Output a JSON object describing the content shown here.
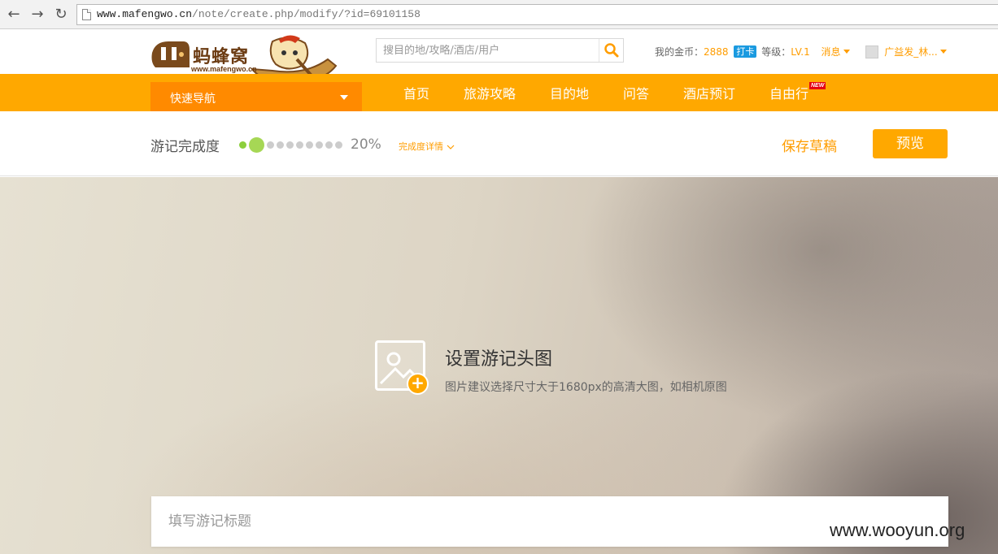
{
  "browser": {
    "back_glyph": "←",
    "forward_glyph": "→",
    "reload_glyph": "↻",
    "url_host": "www.mafengwo.cn",
    "url_path": "/note/create.php/modify/?id=69101158"
  },
  "header": {
    "logo_text": "蚂蜂窝",
    "logo_url": "www.mafengwo.cn",
    "search_placeholder": "搜目的地/攻略/酒店/用户",
    "coins_label": "我的金币：",
    "coins_value": "2888",
    "checkin_label": "打卡",
    "level_label": "等级：",
    "level_value": "LV.1",
    "messages_label": "消息",
    "username": "广益发_林..."
  },
  "nav": {
    "quick_nav": "快速导航",
    "items": [
      "首页",
      "旅游攻略",
      "目的地",
      "问答",
      "酒店预订",
      "自由行"
    ],
    "new_badge": "NEW"
  },
  "progress": {
    "label": "游记完成度",
    "percent_text": "20%",
    "percent_value": 0.2,
    "detail_label": "完成度详情",
    "save_draft": "保存草稿",
    "preview": "预览"
  },
  "cover": {
    "title": "设置游记头图",
    "hint": "图片建议选择尺寸大于1680px的高清大图，如相机原图",
    "plus_glyph": "+"
  },
  "editor": {
    "title_placeholder": "填写游记标题"
  },
  "watermark": "www.wooyun.org",
  "colors": {
    "brand_orange": "#ffa800",
    "quick_nav_orange": "#ff8a00",
    "progress_green": "#a6d755",
    "checkin_blue": "#1a9ae0"
  }
}
